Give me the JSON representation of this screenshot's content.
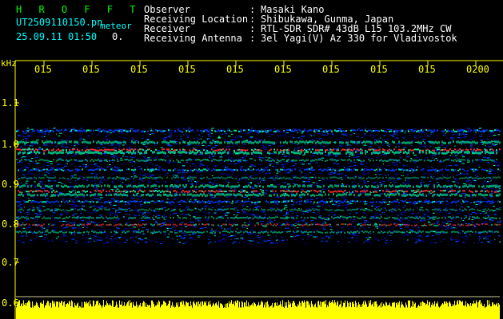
{
  "header": {
    "app_title": "H R O F F T",
    "file_name": "UT2509110150.pn",
    "tag": "meteor",
    "date_time": "25.09.11 01:50",
    "extra": "0.",
    "meta": [
      {
        "label": "Observer",
        "value": "Masaki Kano"
      },
      {
        "label": "Receiving Location",
        "value": "Shibukawa, Gunma, Japan"
      },
      {
        "label": "Receiver",
        "value": "RTL-SDR SDR# 43dB L15 103.2MHz CW"
      },
      {
        "label": "Receiving Antenna",
        "value": "3el Yagi(V) Az 330 for Vladivostok"
      }
    ]
  },
  "spectrogram": {
    "y_unit": "kHz",
    "y_ticks": [
      "1.1",
      "1.0",
      "0.9",
      "0.8",
      "0.7",
      "0.6"
    ],
    "x_ticks": [
      "015",
      "015",
      "015",
      "015",
      "015",
      "015",
      "015",
      "015",
      "015",
      "0200"
    ],
    "colors": {
      "axis": "#ffff00",
      "background": "#000000",
      "noise_low": "#00008b",
      "noise_mid": "#0040ff",
      "signal_mid": "#00ffaa",
      "signal_high": "#ff3030",
      "power_bar": "#ffff00"
    }
  }
}
